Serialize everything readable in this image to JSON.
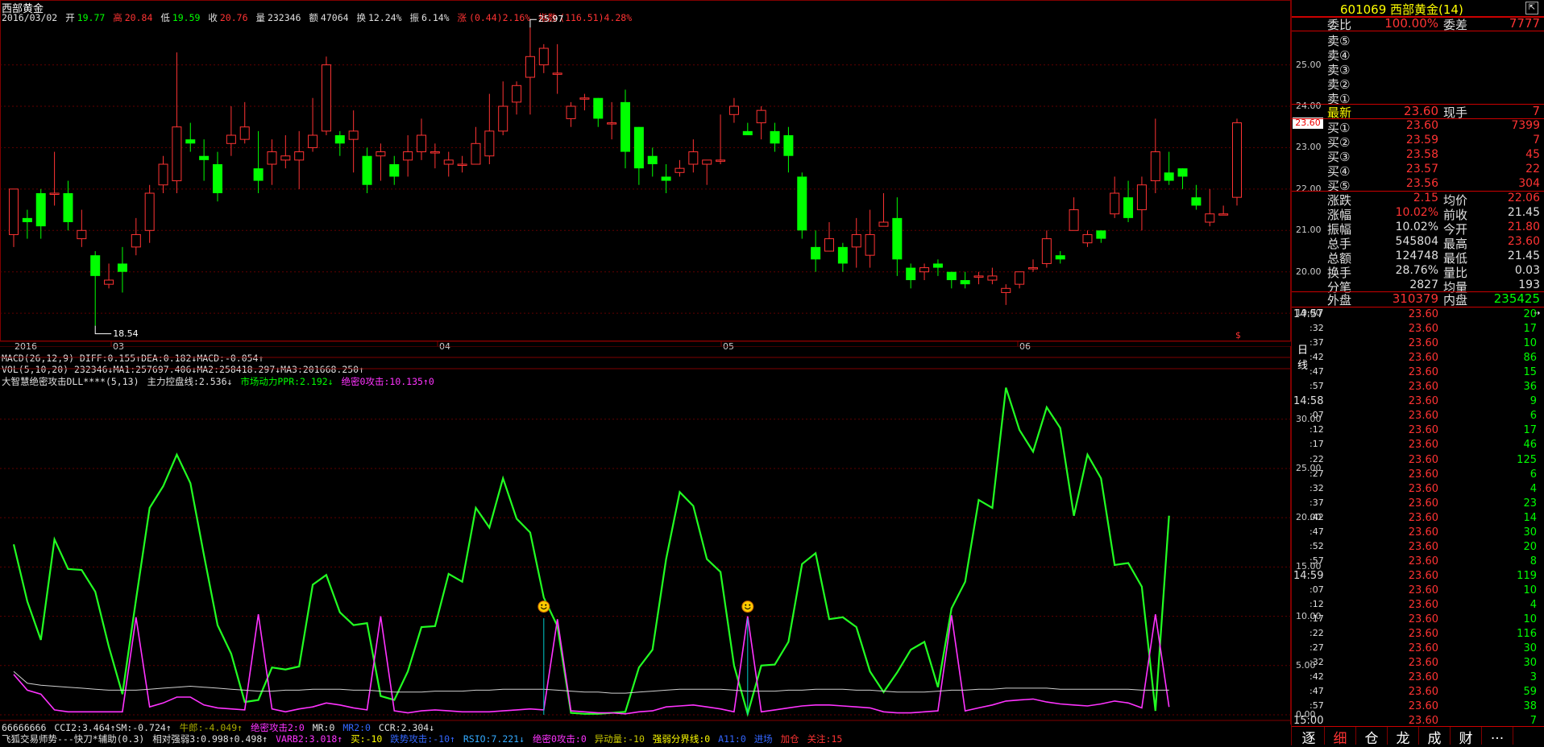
{
  "stock": {
    "name": "西部黄金",
    "code": "601069",
    "code_name": "601069 西部黄金(14)"
  },
  "kline_header": {
    "date": "2016/03/02",
    "open_label": "开",
    "open": "19.77",
    "high_label": "高",
    "high": "20.84",
    "low_label": "低",
    "low": "19.59",
    "close_label": "收",
    "close": "20.76",
    "vol_label": "量",
    "vol": "232346",
    "amt_label": "额",
    "amt": "47064",
    "turnover_label": "换",
    "turnover": "12.24%",
    "amp_label": "振",
    "amp": "6.14%",
    "chg_label": "涨",
    "chg": "(0.44)2.16%",
    "idx_label": "指数",
    "idx": "(116.51)4.28%"
  },
  "price_axis": [
    "25.00",
    "24.00",
    "23.00",
    "22.00",
    "21.00",
    "20.00",
    "19.00"
  ],
  "price_marks": {
    "high": "25.97",
    "low": "18.54",
    "current": "23.60"
  },
  "date_axis": [
    "2016",
    "03",
    "04",
    "05",
    "06"
  ],
  "period_label": "日线",
  "macd_line": "MACD(26,12,9) DIFF:0.155↑DEA:0.182↓MACD:-0.054↑",
  "vol_line": "VOL(5,10,20) 232346↓MA1:257697.406↓MA2:258418.297↓MA3:201668.250↑",
  "dll_line": {
    "name": "大智慧绝密攻击DLL****(5,13)",
    "a": "主力控盘线:2.536↓",
    "b": "市场动力PPR:2.192↓",
    "c": "绝密0攻击:10.135↑0"
  },
  "ind_axis": [
    "30.00",
    "25.00",
    "20.00",
    "15.00",
    "10.00",
    "5.00",
    "0.00"
  ],
  "bottom_line1": {
    "a": "66666666",
    "b": "CCI2:3.464↑SM:-0.724↑",
    "c": "牛郎:-4.049↑",
    "d": "绝密攻击2:0",
    "e": "MR:0",
    "f": "MR2:0",
    "g": "CCR:2.304↓"
  },
  "bottom_line2": {
    "a": "飞狐交易师势---快刀*辅助(0.3)",
    "b": "相对强弱3:0.998↑0.498↑",
    "c": "VARB2:3.018↑",
    "d": "买:-10",
    "e": "跌势攻击:-10↑",
    "f": "RSIO:7.221↓",
    "g": "绝密0攻击:0",
    "h": "异动量:-10",
    "i": "强弱分界线:0",
    "j": "A11:0",
    "k": "进场",
    "l": "加仓",
    "m": "关注:15"
  },
  "quote": {
    "webi_label": "委比",
    "webi": "100.00%",
    "weicha_label": "委差",
    "weicha": "7777",
    "sells": [
      {
        "label": "卖⑤"
      },
      {
        "label": "卖④"
      },
      {
        "label": "卖③"
      },
      {
        "label": "卖②"
      },
      {
        "label": "卖①"
      }
    ],
    "latest_label": "最新",
    "latest": "23.60",
    "xianshou_label": "现手",
    "xianshou": "7",
    "buys": [
      {
        "label": "买①",
        "price": "23.60",
        "vol": "7399"
      },
      {
        "label": "买②",
        "price": "23.59",
        "vol": "7"
      },
      {
        "label": "买③",
        "price": "23.58",
        "vol": "45"
      },
      {
        "label": "买④",
        "price": "23.57",
        "vol": "22"
      },
      {
        "label": "买⑤",
        "price": "23.56",
        "vol": "304"
      }
    ],
    "stats": [
      {
        "l1": "涨跌",
        "v1": "2.15",
        "l2": "均价",
        "v2": "22.06",
        "c1": "red",
        "c2": "red"
      },
      {
        "l1": "涨幅",
        "v1": "10.02%",
        "l2": "前收",
        "v2": "21.45",
        "c1": "red",
        "c2": "white"
      },
      {
        "l1": "振幅",
        "v1": "10.02%",
        "l2": "今开",
        "v2": "21.80",
        "c1": "white",
        "c2": "red"
      },
      {
        "l1": "总手",
        "v1": "545804",
        "l2": "最高",
        "v2": "23.60",
        "c1": "white",
        "c2": "red"
      },
      {
        "l1": "总额",
        "v1": "124748",
        "l2": "最低",
        "v2": "21.45",
        "c1": "white",
        "c2": "white"
      },
      {
        "l1": "换手",
        "v1": "28.76%",
        "l2": "量比",
        "v2": "0.03",
        "c1": "white",
        "c2": "white"
      },
      {
        "l1": "分笔",
        "v1": "2827",
        "l2": "均量",
        "v2": "193",
        "c1": "white",
        "c2": "white"
      }
    ],
    "waipan_label": "外盘",
    "waipan": "310379",
    "neipan_label": "内盘",
    "neipan": "235425"
  },
  "ticks": [
    {
      "t": "14:57",
      "p": "23.60",
      "v": "20"
    },
    {
      "t": ":32",
      "p": "23.60",
      "v": "17"
    },
    {
      "t": ":37",
      "p": "23.60",
      "v": "10"
    },
    {
      "t": ":42",
      "p": "23.60",
      "v": "86"
    },
    {
      "t": ":47",
      "p": "23.60",
      "v": "15"
    },
    {
      "t": ":57",
      "p": "23.60",
      "v": "36"
    },
    {
      "t": "14:58",
      "p": "23.60",
      "v": "9"
    },
    {
      "t": ":07",
      "p": "23.60",
      "v": "6"
    },
    {
      "t": ":12",
      "p": "23.60",
      "v": "17"
    },
    {
      "t": ":17",
      "p": "23.60",
      "v": "46"
    },
    {
      "t": ":22",
      "p": "23.60",
      "v": "125"
    },
    {
      "t": ":27",
      "p": "23.60",
      "v": "6"
    },
    {
      "t": ":32",
      "p": "23.60",
      "v": "4"
    },
    {
      "t": ":37",
      "p": "23.60",
      "v": "23"
    },
    {
      "t": ":42",
      "p": "23.60",
      "v": "14"
    },
    {
      "t": ":47",
      "p": "23.60",
      "v": "30"
    },
    {
      "t": ":52",
      "p": "23.60",
      "v": "20"
    },
    {
      "t": ":57",
      "p": "23.60",
      "v": "8"
    },
    {
      "t": "14:59",
      "p": "23.60",
      "v": "119"
    },
    {
      "t": ":07",
      "p": "23.60",
      "v": "10"
    },
    {
      "t": ":12",
      "p": "23.60",
      "v": "4"
    },
    {
      "t": ":17",
      "p": "23.60",
      "v": "10"
    },
    {
      "t": ":22",
      "p": "23.60",
      "v": "116"
    },
    {
      "t": ":27",
      "p": "23.60",
      "v": "30"
    },
    {
      "t": ":32",
      "p": "23.60",
      "v": "30"
    },
    {
      "t": ":42",
      "p": "23.60",
      "v": "3"
    },
    {
      "t": ":47",
      "p": "23.60",
      "v": "59"
    },
    {
      "t": ":57",
      "p": "23.60",
      "v": "38"
    },
    {
      "t": "15:00",
      "p": "23.60",
      "v": "7"
    }
  ],
  "tabs": [
    "逐",
    "细",
    "仓",
    "龙",
    "成",
    "财",
    "..."
  ],
  "colors": {
    "up": "#ff3333",
    "down": "#00ff00",
    "grid": "#800000",
    "magenta": "#ff33ff",
    "pink": "#ff66ff"
  },
  "chart_data": [
    {
      "type": "candlestick",
      "title": "西部黄金",
      "ylim": [
        18.4,
        26.1
      ],
      "x_labels": [
        "2016",
        "03",
        "04",
        "05",
        "06"
      ],
      "candles": [
        [
          20.9,
          22.0,
          20.6,
          21.6
        ],
        [
          21.3,
          21.2,
          20.8,
          21.5
        ],
        [
          21.9,
          21.1,
          20.8,
          22.0
        ],
        [
          21.9,
          21.9,
          21.6,
          22.9
        ],
        [
          21.9,
          21.2,
          21.0,
          22.2
        ],
        [
          20.8,
          21.0,
          20.6,
          21.5
        ],
        [
          20.4,
          19.9,
          18.7,
          20.5
        ],
        [
          19.7,
          19.8,
          19.6,
          20.2
        ],
        [
          20.2,
          20.0,
          19.5,
          20.6
        ],
        [
          20.6,
          20.9,
          20.4,
          21.3
        ],
        [
          21.0,
          21.9,
          20.7,
          22.1
        ],
        [
          22.1,
          22.6,
          21.9,
          22.8
        ],
        [
          22.2,
          23.5,
          21.9,
          25.3
        ],
        [
          23.2,
          23.1,
          22.9,
          23.6
        ],
        [
          22.8,
          22.7,
          22.2,
          23.2
        ],
        [
          22.6,
          21.9,
          21.7,
          22.9
        ],
        [
          23.1,
          23.3,
          22.8,
          24.0
        ],
        [
          23.2,
          23.5,
          23.1,
          24.1
        ],
        [
          22.5,
          22.2,
          21.9,
          23.4
        ],
        [
          22.6,
          22.9,
          22.1,
          23.2
        ],
        [
          22.7,
          22.8,
          22.5,
          23.3
        ],
        [
          22.7,
          22.9,
          22.0,
          23.4
        ],
        [
          23.0,
          23.3,
          22.9,
          24.2
        ],
        [
          23.4,
          25.0,
          23.3,
          25.2
        ],
        [
          23.3,
          23.1,
          22.8,
          23.4
        ],
        [
          23.2,
          23.4,
          22.4,
          23.9
        ],
        [
          22.8,
          22.1,
          21.9,
          23.0
        ],
        [
          22.8,
          22.9,
          22.2,
          23.1
        ],
        [
          22.6,
          22.3,
          22.1,
          22.8
        ],
        [
          22.7,
          22.9,
          22.3,
          23.3
        ],
        [
          22.9,
          23.3,
          22.7,
          23.7
        ],
        [
          22.9,
          22.9,
          22.5,
          23.1
        ],
        [
          22.6,
          22.7,
          22.3,
          22.9
        ],
        [
          22.6,
          22.6,
          22.4,
          22.8
        ],
        [
          22.6,
          23.1,
          22.6,
          23.5
        ],
        [
          22.8,
          23.4,
          22.6,
          24.3
        ],
        [
          23.4,
          24.0,
          23.3,
          24.6
        ],
        [
          24.1,
          24.5,
          23.8,
          24.6
        ],
        [
          24.7,
          25.2,
          23.8,
          25.9
        ],
        [
          25.0,
          25.4,
          24.8,
          25.5
        ],
        [
          24.8,
          24.8,
          24.3,
          25.5
        ],
        [
          23.7,
          24.0,
          23.5,
          24.1
        ],
        [
          24.2,
          24.2,
          23.9,
          24.3
        ],
        [
          24.2,
          23.7,
          23.5,
          24.2
        ],
        [
          23.6,
          23.6,
          23.2,
          24.1
        ],
        [
          24.1,
          22.9,
          22.5,
          24.4
        ],
        [
          23.5,
          22.5,
          22.1,
          23.5
        ],
        [
          22.8,
          22.6,
          22.3,
          23.0
        ],
        [
          22.3,
          22.2,
          21.9,
          22.6
        ],
        [
          22.4,
          22.5,
          22.3,
          22.7
        ],
        [
          22.6,
          22.9,
          22.4,
          23.2
        ],
        [
          22.6,
          22.7,
          22.1,
          22.7
        ],
        [
          22.7,
          22.7,
          22.6,
          23.8
        ],
        [
          23.8,
          24.0,
          23.6,
          24.2
        ],
        [
          23.4,
          23.3,
          23.3,
          23.6
        ],
        [
          23.6,
          23.9,
          23.2,
          24.0
        ],
        [
          23.4,
          23.1,
          22.9,
          23.6
        ],
        [
          23.3,
          22.8,
          22.4,
          23.5
        ],
        [
          22.3,
          21.0,
          20.8,
          22.4
        ],
        [
          20.6,
          20.3,
          20.0,
          21.0
        ],
        [
          20.5,
          20.8,
          20.5,
          21.2
        ],
        [
          20.6,
          20.2,
          20.0,
          20.7
        ],
        [
          20.6,
          20.9,
          20.1,
          21.3
        ],
        [
          20.4,
          20.9,
          20.1,
          21.5
        ],
        [
          21.1,
          21.2,
          21.1,
          21.9
        ],
        [
          21.3,
          20.3,
          19.9,
          21.8
        ],
        [
          20.1,
          19.8,
          19.6,
          20.2
        ],
        [
          20.0,
          20.1,
          19.8,
          20.2
        ],
        [
          20.2,
          20.1,
          19.9,
          20.3
        ],
        [
          20.0,
          19.8,
          19.6,
          20.0
        ],
        [
          19.8,
          19.7,
          19.6,
          20.0
        ],
        [
          19.9,
          19.9,
          19.7,
          20.0
        ],
        [
          19.8,
          19.9,
          19.7,
          20.1
        ],
        [
          19.5,
          19.6,
          19.2,
          19.7
        ],
        [
          19.7,
          20.0,
          19.6,
          20.0
        ],
        [
          20.1,
          20.1,
          20.0,
          20.3
        ],
        [
          20.2,
          20.8,
          20.1,
          21.0
        ],
        [
          20.4,
          20.3,
          20.2,
          20.5
        ],
        [
          21.0,
          21.5,
          21.0,
          21.8
        ],
        [
          20.7,
          20.9,
          20.6,
          21.0
        ],
        [
          21.0,
          20.8,
          20.7,
          21.0
        ],
        [
          21.4,
          21.9,
          21.3,
          22.3
        ],
        [
          21.8,
          21.3,
          21.2,
          22.2
        ],
        [
          21.5,
          22.1,
          21.0,
          22.3
        ],
        [
          22.2,
          22.9,
          21.9,
          23.7
        ],
        [
          22.4,
          22.2,
          22.1,
          22.9
        ],
        [
          22.5,
          22.3,
          22.0,
          22.5
        ],
        [
          21.8,
          21.6,
          21.5,
          22.1
        ],
        [
          21.2,
          21.4,
          21.1,
          22.0
        ],
        [
          21.4,
          21.4,
          21.4,
          21.6
        ],
        [
          21.8,
          23.6,
          21.6,
          23.7
        ]
      ]
    },
    {
      "type": "line",
      "ylim": [
        0,
        33
      ],
      "y_ticks": [
        "30.00",
        "25.00",
        "20.00",
        "15.00",
        "10.00",
        "5.00",
        "0.00"
      ],
      "series": [
        {
          "color": "#22ff22",
          "values": [
            17.3,
            11.5,
            7.6,
            17.8,
            14.8,
            14.7,
            12.5,
            6.9,
            2.1,
            11.7,
            21.0,
            23.2,
            26.4,
            23.5,
            16.2,
            9.1,
            6.2,
            1.3,
            1.5,
            4.8,
            4.6,
            4.9,
            13.2,
            14.2,
            10.4,
            9.1,
            9.3,
            1.9,
            1.5,
            4.4,
            8.9,
            9.0,
            14.3,
            13.5,
            21.0,
            19.0,
            24.0,
            19.9,
            18.5,
            11.9,
            9.0,
            0.2,
            0.1,
            0.1,
            0.2,
            0.3,
            4.8,
            6.6,
            15.8,
            22.6,
            21.2,
            15.8,
            14.5,
            5.0,
            0.1,
            5.0,
            5.1,
            7.4,
            15.3,
            16.4,
            9.7,
            9.9,
            8.9,
            4.4,
            2.3,
            4.3,
            6.6,
            7.4,
            2.8,
            10.8,
            13.5,
            21.8,
            21.0,
            33.2,
            28.9,
            26.7,
            31.2,
            29.1,
            20.2,
            26.4,
            24.0,
            15.2,
            15.4,
            13.0,
            0.4,
            20.2
          ]
        },
        {
          "color": "#ff33ff",
          "values": [
            4.1,
            2.5,
            2.1,
            0.5,
            0.3,
            0.3,
            0.3,
            0.3,
            0.3,
            9.9,
            0.8,
            1.2,
            1.8,
            1.8,
            1.0,
            0.7,
            0.6,
            0.5,
            10.2,
            0.6,
            0.3,
            0.6,
            0.8,
            1.2,
            1.0,
            0.7,
            0.5,
            10.0,
            0.4,
            0.2,
            0.4,
            0.5,
            0.4,
            0.3,
            0.3,
            0.3,
            0.4,
            0.5,
            0.6,
            0.5,
            9.7,
            0.4,
            0.3,
            0.2,
            0.2,
            0.1,
            0.3,
            0.4,
            0.8,
            0.9,
            1.0,
            0.8,
            0.6,
            0.3,
            10.0,
            0.3,
            0.5,
            0.7,
            0.9,
            1.0,
            1.0,
            0.9,
            0.8,
            0.7,
            0.3,
            0.2,
            0.2,
            0.3,
            0.4,
            10.1,
            0.4,
            0.7,
            1.0,
            1.4,
            1.5,
            1.6,
            1.3,
            1.1,
            1.0,
            0.9,
            1.1,
            1.4,
            1.2,
            0.7,
            10.2,
            0.8
          ]
        },
        {
          "color": "#d0d0d0",
          "values": [
            4.4,
            3.2,
            3.0,
            2.9,
            2.8,
            2.7,
            2.6,
            2.5,
            2.5,
            2.5,
            2.6,
            2.7,
            2.8,
            2.9,
            2.8,
            2.7,
            2.6,
            2.5,
            2.4,
            2.4,
            2.5,
            2.5,
            2.6,
            2.6,
            2.6,
            2.5,
            2.5,
            2.4,
            2.3,
            2.3,
            2.3,
            2.4,
            2.4,
            2.4,
            2.5,
            2.5,
            2.6,
            2.6,
            2.6,
            2.6,
            2.5,
            2.4,
            2.3,
            2.3,
            2.2,
            2.2,
            2.3,
            2.4,
            2.5,
            2.6,
            2.6,
            2.6,
            2.6,
            2.5,
            2.4,
            2.4,
            2.4,
            2.5,
            2.5,
            2.6,
            2.6,
            2.6,
            2.5,
            2.5,
            2.4,
            2.3,
            2.3,
            2.3,
            2.4,
            2.5,
            2.5,
            2.6,
            2.6,
            2.7,
            2.7,
            2.7,
            2.7,
            2.6,
            2.6,
            2.6,
            2.6,
            2.6,
            2.6,
            2.5,
            2.5,
            2.5
          ]
        }
      ],
      "markers": [
        39,
        54
      ]
    }
  ]
}
